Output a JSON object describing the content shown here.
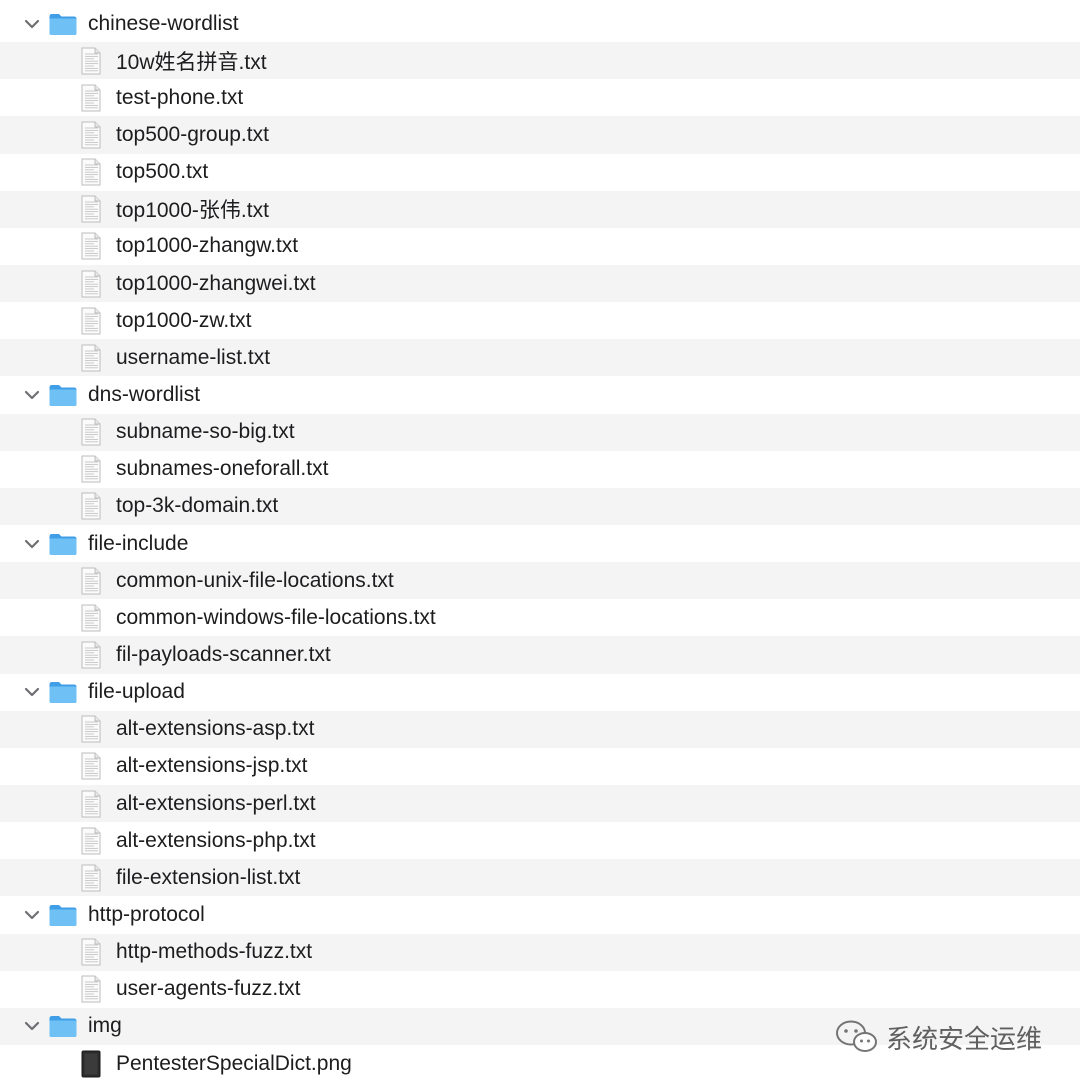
{
  "tree": [
    {
      "name": "chinese-wordlist",
      "files": [
        "10w姓名拼音.txt",
        "test-phone.txt",
        "top500-group.txt",
        "top500.txt",
        "top1000-张伟.txt",
        "top1000-zhangw.txt",
        "top1000-zhangwei.txt",
        "top1000-zw.txt",
        "username-list.txt"
      ]
    },
    {
      "name": "dns-wordlist",
      "files": [
        "subname-so-big.txt",
        "subnames-oneforall.txt",
        "top-3k-domain.txt"
      ]
    },
    {
      "name": "file-include",
      "files": [
        "common-unix-file-locations.txt",
        "common-windows-file-locations.txt",
        "fil-payloads-scanner.txt"
      ]
    },
    {
      "name": "file-upload",
      "files": [
        "alt-extensions-asp.txt",
        "alt-extensions-jsp.txt",
        "alt-extensions-perl.txt",
        "alt-extensions-php.txt",
        "file-extension-list.txt"
      ]
    },
    {
      "name": "http-protocol",
      "files": [
        "http-methods-fuzz.txt",
        "user-agents-fuzz.txt"
      ]
    },
    {
      "name": "img",
      "files": [
        "PentesterSpecialDict.png"
      ]
    }
  ],
  "watermark": {
    "text": "系统安全运维",
    "icon": "wechat-icon"
  },
  "icons": {
    "folder": "folder-icon",
    "file": "text-file-icon",
    "image_file": "image-file-icon",
    "chevron": "chevron-down-icon"
  },
  "colors": {
    "row_alt": "#f4f4f5",
    "folder": "#5fb3f0",
    "text": "#1d1d1f"
  }
}
